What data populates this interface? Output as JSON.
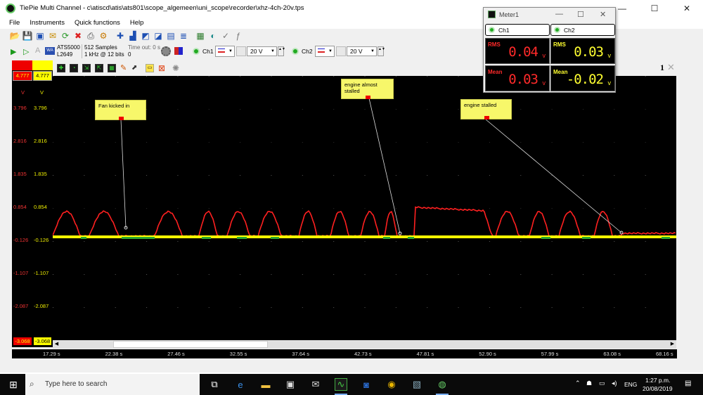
{
  "title": "TiePie Multi Channel - c\\atiscd\\atis\\ats801\\scope_algemeen\\uni_scope\\recorder\\xhz-4ch-20v.tps",
  "window_controls": {
    "minimize": "—",
    "maximize": "☐",
    "close": "✕"
  },
  "menu": [
    "File",
    "Instruments",
    "Quick functions",
    "Help"
  ],
  "instrument": {
    "name": "ATS5000",
    "serial": "L2649",
    "samples": "512 Samples",
    "rate": "1 kHz @ 12 bits",
    "timeout_label": "Time out: 0 s",
    "timeout_value": "0"
  },
  "channels": [
    {
      "name": "Ch1",
      "range": "20 V"
    },
    {
      "name": "Ch2",
      "range": "20 V"
    }
  ],
  "scope": {
    "window_number": "1",
    "ch1_ticks": [
      "4.777",
      "V",
      "3.796",
      "2.816",
      "1.835",
      "0.854",
      "-0.126",
      "-1.107",
      "-2.087",
      "-3.068"
    ],
    "ch2_ticks": [
      "4.777",
      "V",
      "3.796",
      "2.816",
      "1.835",
      "0.854",
      "-0.126",
      "-1.107",
      "-2.087",
      "-3.068"
    ],
    "time_ticks": [
      "17.29 s",
      "22.38 s",
      "27.46 s",
      "32.55 s",
      "37.64 s",
      "42.73 s",
      "47.81 s",
      "52.90 s",
      "57.99 s",
      "63.08 s",
      "68.16 s"
    ],
    "annotations": [
      "Fan kicked in",
      "engine almost stalled",
      "engine stalled"
    ],
    "colors": {
      "ch1": "#ff2020",
      "ch2": "#ffff00"
    }
  },
  "meter": {
    "title": "Meter1",
    "tabs": [
      "Ch1",
      "Ch2"
    ],
    "cells": [
      {
        "label": "RMS",
        "value": "0.04",
        "unit": "v",
        "color": "#ff2a2a"
      },
      {
        "label": "RMS",
        "value": "0.03",
        "unit": "v",
        "color": "#ffff30"
      },
      {
        "label": "Mean",
        "value": "0.03",
        "unit": "v",
        "color": "#ff2a2a"
      },
      {
        "label": "Mean",
        "value": "-0.02",
        "unit": "v",
        "color": "#ffff30"
      }
    ]
  },
  "taskbar": {
    "search_placeholder": "Type here to search",
    "language": "ENG",
    "time": "1:27 p.m.",
    "date": "20/08/2019"
  }
}
